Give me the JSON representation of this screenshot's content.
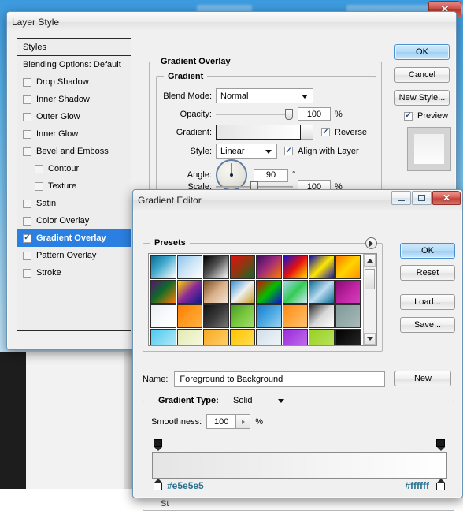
{
  "desktop": {
    "close_label": "✕"
  },
  "layer_style": {
    "title": "Layer Style",
    "styles_panel": {
      "header": "Styles",
      "default_item": "Blending Options: Default",
      "items": [
        {
          "label": "Drop Shadow",
          "checked": false,
          "indent": false,
          "selected": false
        },
        {
          "label": "Inner Shadow",
          "checked": false,
          "indent": false,
          "selected": false
        },
        {
          "label": "Outer Glow",
          "checked": false,
          "indent": false,
          "selected": false
        },
        {
          "label": "Inner Glow",
          "checked": false,
          "indent": false,
          "selected": false
        },
        {
          "label": "Bevel and Emboss",
          "checked": false,
          "indent": false,
          "selected": false
        },
        {
          "label": "Contour",
          "checked": false,
          "indent": true,
          "selected": false
        },
        {
          "label": "Texture",
          "checked": false,
          "indent": true,
          "selected": false
        },
        {
          "label": "Satin",
          "checked": false,
          "indent": false,
          "selected": false
        },
        {
          "label": "Color Overlay",
          "checked": false,
          "indent": false,
          "selected": false
        },
        {
          "label": "Gradient Overlay",
          "checked": true,
          "indent": false,
          "selected": true
        },
        {
          "label": "Pattern Overlay",
          "checked": false,
          "indent": false,
          "selected": false
        },
        {
          "label": "Stroke",
          "checked": false,
          "indent": false,
          "selected": false
        }
      ]
    },
    "gradient_overlay": {
      "section_title": "Gradient Overlay",
      "group_title": "Gradient",
      "blend_mode_label": "Blend Mode:",
      "blend_mode_value": "Normal",
      "opacity_label": "Opacity:",
      "opacity_value": "100",
      "opacity_unit": "%",
      "gradient_label": "Gradient:",
      "gradient_from": "#e5e5e5",
      "gradient_to": "#ffffff",
      "reverse_label": "Reverse",
      "reverse_checked": true,
      "style_label": "Style:",
      "style_value": "Linear",
      "align_label": "Align with Layer",
      "align_checked": true,
      "angle_label": "Angle:",
      "angle_value": "90",
      "angle_unit": "°",
      "scale_label": "Scale:",
      "scale_value": "100",
      "scale_unit": "%"
    },
    "buttons": {
      "ok": "OK",
      "cancel": "Cancel",
      "new_style": "New Style...",
      "preview_label": "Preview",
      "preview_checked": true
    }
  },
  "gradient_editor": {
    "title": "Gradient Editor",
    "window_buttons": {
      "minimize": "",
      "maximize": "",
      "close": "✕"
    },
    "presets": {
      "legend": "Presets",
      "swatches": [
        "linear-gradient(135deg,#0a6c92 0%,#3fa8cc 40%,#ffffff 100%)",
        "linear-gradient(135deg,#8fc4ea 0%,#cfe6f7 50%,#ffffff 100%)",
        "linear-gradient(135deg,#000000 0%,#555555 45%,#ffffff 100%)",
        "linear-gradient(135deg,#e01010 0%,#8a3a12 50%,#0c6b2a 100%)",
        "linear-gradient(135deg,#3b1060 0%,#a02a7a 45%,#ff7a00 100%)",
        "linear-gradient(135deg,#1a10c8 0%,#e61010 50%,#ffe000 100%)",
        "linear-gradient(135deg,#120fa8 0%,#ffe800 50%,#1410b0 100%)",
        "linear-gradient(135deg,#ff7a00 0%,#ffd400 50%,#ff9000 100%)",
        "linear-gradient(135deg,#5a1070 0%,#0c6b2a 45%,#ff7a00 100%)",
        "linear-gradient(135deg,#ffd400 0%,#8a2a9a 50%,#0d1a8a 100%)",
        "linear-gradient(135deg,#7a4a20 0%,#d9b089 50%,#f3e6d8 100%)",
        "linear-gradient(135deg,#2f8fd8 0%,#f0f0f0 50%,#c89a22 100%)",
        "linear-gradient(135deg,#e60000 0%,#00c000 50%,#1010d0 100%)",
        "linear-gradient(135deg,#a7d4ef 0%,#33cc55 50%,#cfe6f7 100%)",
        "linear-gradient(135deg,#0a6c92 0%,#bcdcf2 50%,#0a6c92 100%)",
        "linear-gradient(135deg,#8a0a72 0%,#c428a8 60%,#d040b8 100%)",
        "linear-gradient(135deg,#e8eef4 0%,#f7fafc 50%,#ffffff 100%)",
        "linear-gradient(135deg,#ff7a00 0%,#ff9a22 50%,#ffb040 100%)",
        "linear-gradient(135deg,#111111 0%,#3a3a3a 50%,#7a7a7a 100%)",
        "linear-gradient(135deg,#4a9a22 0%,#78c840 50%,#a8dc70 100%)",
        "linear-gradient(135deg,#1a7ac8 0%,#4aa8e2 50%,#9fd2f0 100%)",
        "linear-gradient(135deg,#ff8a10 0%,#ffa840 50%,#ffc070 100%)",
        "linear-gradient(135deg,#2f2f2f 0%,#d8d8d8 50%,#ffffff 100%)",
        "linear-gradient(135deg,#7f9a99 0%,#93aaa8 50%,#a8bcba 100%)",
        "linear-gradient(135deg,#4ec8f0 0%,#86dcf4 50%,#c0ecfa 100%)",
        "linear-gradient(135deg,#e2eab0 0%,#eef3cc 50%,#f6f9e4 100%)",
        "linear-gradient(135deg,#f8a820 0%,#fbc04c 50%,#fdd378 100%)",
        "linear-gradient(135deg,#ffc400 0%,#ffd230 50%,#ffe068 100%)",
        "linear-gradient(135deg,#cfdde8 0%,#e2ecf3 50%,#f2f7fa 100%)",
        "linear-gradient(135deg,#9a2ad8 0%,#b050e4 50%,#c478ec 100%)",
        "linear-gradient(135deg,#9ad020 0%,#aada44 50%,#bfe468 100%)",
        "linear-gradient(135deg,#000000 0%,#161616 50%,#2a2a2a 100%)"
      ]
    },
    "name_label": "Name:",
    "name_value": "Foreground to Background",
    "gradient_type_label": "Gradient Type:",
    "gradient_type_value": "Solid",
    "smoothness_label": "Smoothness:",
    "smoothness_value": "100",
    "smoothness_unit": "%",
    "stop_left_hex": "#e5e5e5",
    "stop_right_hex": "#ffffff",
    "stops_partial_label": "St",
    "buttons": {
      "ok": "OK",
      "reset": "Reset",
      "load": "Load...",
      "save": "Save...",
      "new": "New"
    }
  }
}
